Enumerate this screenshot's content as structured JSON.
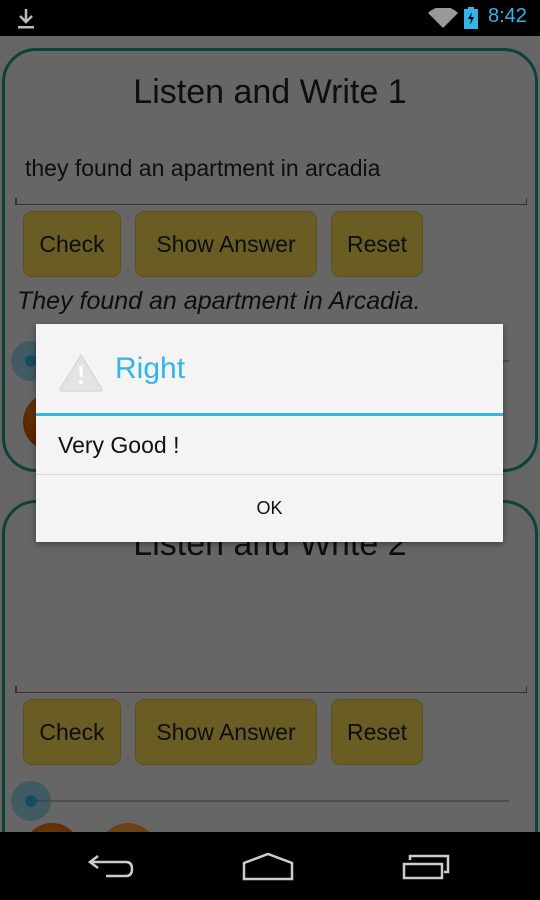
{
  "status_bar": {
    "time": "8:42",
    "icons": [
      "download-icon",
      "wifi-icon",
      "battery-charging-icon"
    ]
  },
  "cards": [
    {
      "title": "Listen and Write 1",
      "input_value": "they found an apartment in arcadia",
      "buttons": {
        "check": "Check",
        "show_answer": "Show Answer",
        "reset": "Reset"
      },
      "answer_text": "They found an apartment in Arcadia.",
      "seek_progress": 0
    },
    {
      "title": "Listen and Write 2",
      "input_value": "",
      "buttons": {
        "check": "Check",
        "show_answer": "Show Answer",
        "reset": "Reset"
      },
      "answer_text": "",
      "seek_progress": 0
    }
  ],
  "dialog": {
    "icon": "warning-icon",
    "title": "Right",
    "message": "Very Good !",
    "ok_label": "OK"
  },
  "colors": {
    "accent": "#33b5e5",
    "card_border": "#1d9e8a",
    "button": "#fadd55",
    "play": "#e06a00"
  },
  "nav_bar": {
    "icons": [
      "back-icon",
      "home-icon",
      "recent-apps-icon"
    ]
  }
}
